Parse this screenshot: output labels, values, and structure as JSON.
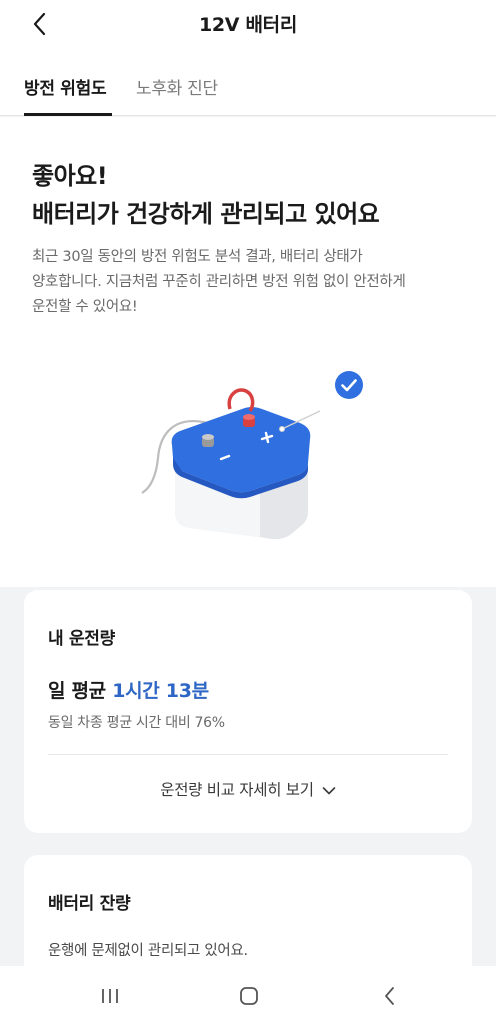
{
  "header": {
    "title": "12V 배터리",
    "back_icon": "chevron-left-icon"
  },
  "tabs": [
    {
      "label": "방전 위험도",
      "active": true
    },
    {
      "label": "노후화 진단",
      "active": false
    }
  ],
  "hero": {
    "headline_line1": "좋아요!",
    "headline_line2": "배터리가 건강하게 관리되고 있어요",
    "desc_line1": "최근 30일 동안의 방전 위험도 분석 결과, 배터리 상태가",
    "desc_line2": "양호합니다. 지금처럼 꾸준히 관리하면 방전 위험 없이 안전하게",
    "desc_line3": "운전할 수 있어요!"
  },
  "driving_card": {
    "title": "내 운전량",
    "avg_label": "일 평균",
    "avg_value": "1시간 13분",
    "comparison": "동일 차종 평균 시간 대비 76%",
    "detail_label": "운전량 비교 자세히 보기"
  },
  "battery_card": {
    "title": "배터리 잔량",
    "status": "운행에 문제없이 관리되고 있어요."
  },
  "colors": {
    "accent": "#2d66c4",
    "battery_blue": "#2f6fe0",
    "check_blue": "#2f6fe0"
  }
}
